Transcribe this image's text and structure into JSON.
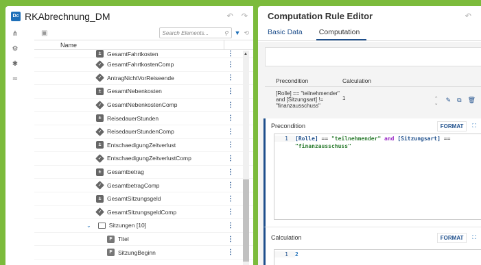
{
  "app": {
    "badge": "Dc",
    "title": "RKAbrechnung_DM"
  },
  "tree": {
    "search_placeholder": "Search Elements...",
    "column_name": "Name",
    "items": [
      {
        "label": "GesamtFahrtkosten",
        "icon": "calculator-icon",
        "partial": true
      },
      {
        "label": "GesamtFahrtkostenComp",
        "icon": "diamond-icon"
      },
      {
        "label": "AntragNichtVorReiseende",
        "icon": "diamond-icon"
      },
      {
        "label": "GesamtNebenkosten",
        "icon": "calculator-icon"
      },
      {
        "label": "GesamtNebenkostenComp",
        "icon": "diamond-icon"
      },
      {
        "label": "ReisedauerStunden",
        "icon": "calculator-icon"
      },
      {
        "label": "ReisedauerStundenComp",
        "icon": "diamond-icon"
      },
      {
        "label": "EntschaedigungZeitverlust",
        "icon": "calculator-icon"
      },
      {
        "label": "EntschaedigungZeitverlustComp",
        "icon": "diamond-icon"
      },
      {
        "label": "Gesamtbetrag",
        "icon": "calculator-icon"
      },
      {
        "label": "GesamtbetragComp",
        "icon": "diamond-icon"
      },
      {
        "label": "GesamtSitzungsgeld",
        "icon": "calculator-icon"
      },
      {
        "label": "GesamtSitzungsgeldComp",
        "icon": "diamond-icon"
      },
      {
        "label": "Sitzungen [10]",
        "icon": "folder-icon",
        "expanded": true
      },
      {
        "label": "Titel",
        "icon": "field-icon",
        "child": true
      },
      {
        "label": "SitzungBeginn",
        "icon": "field-icon",
        "child": true
      }
    ]
  },
  "editor": {
    "title": "Computation Rule Editor",
    "tabs": [
      "Basic Data",
      "Computation"
    ],
    "active_tab": "Computation",
    "table": {
      "col_precondition": "Precondition",
      "col_calculation": "Calculation",
      "row_precondition_line1": "[Rolle] == \"teilnehmender\"",
      "row_precondition_line2": "and [Sitzungsart] !=",
      "row_precondition_line3": "\"finanzausschuss\"",
      "row_calculation": "1"
    },
    "precondition": {
      "label": "Precondition",
      "format_label": "FORMAT",
      "line_number": "1",
      "code_var1": "[Rolle]",
      "code_op1": " == ",
      "code_str1": "\"teilnehmender\"",
      "code_and": " and ",
      "code_var2": "[Sitzungsart]",
      "code_op2": " ==",
      "code_str2": "\"finanzausschuss\""
    },
    "calculation": {
      "label": "Calculation",
      "format_label": "FORMAT",
      "line_number": "1",
      "code": "2"
    }
  },
  "colors": {
    "background": "#7cbb3c",
    "accent": "#1e4f8c",
    "keyword": "#9b2dc7",
    "string": "#2e7d32"
  }
}
